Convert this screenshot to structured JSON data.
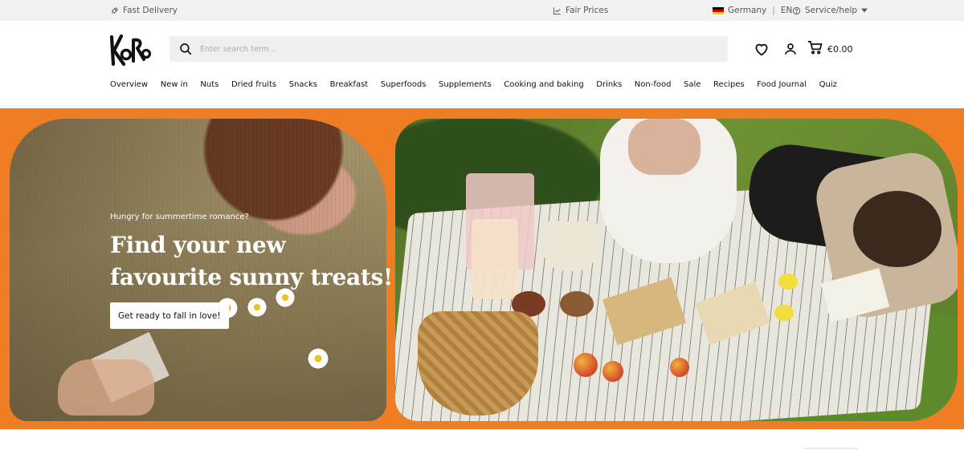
{
  "topbar": {
    "delivery": "Fast Delivery",
    "prices": "Fair Prices",
    "country": "Germany",
    "language": "EN",
    "service": "Service/help",
    "delivery_icon": "rocket-icon",
    "prices_icon": "chart-icon",
    "country_icon": "germany-flag-icon",
    "service_icon": "help-circle-icon"
  },
  "header": {
    "logo_text": "KoRo",
    "search_placeholder": "Enter search term...",
    "cart_total": "€0.00",
    "icons": [
      "search-icon",
      "heart-icon",
      "user-icon",
      "cart-icon"
    ]
  },
  "nav": {
    "items": [
      "Overview",
      "New in",
      "Nuts",
      "Dried fruits",
      "Snacks",
      "Breakfast",
      "Superfoods",
      "Supplements",
      "Cooking and baking",
      "Drinks",
      "Non-food",
      "Sale",
      "Recipes",
      "Food Journal",
      "Quiz"
    ]
  },
  "hero": {
    "eyebrow": "Hungry for summertime romance?",
    "headline": "Find your new favourite sunny treats!",
    "cta": "Get ready to fall in love!",
    "background_color": "#ee7d24"
  }
}
